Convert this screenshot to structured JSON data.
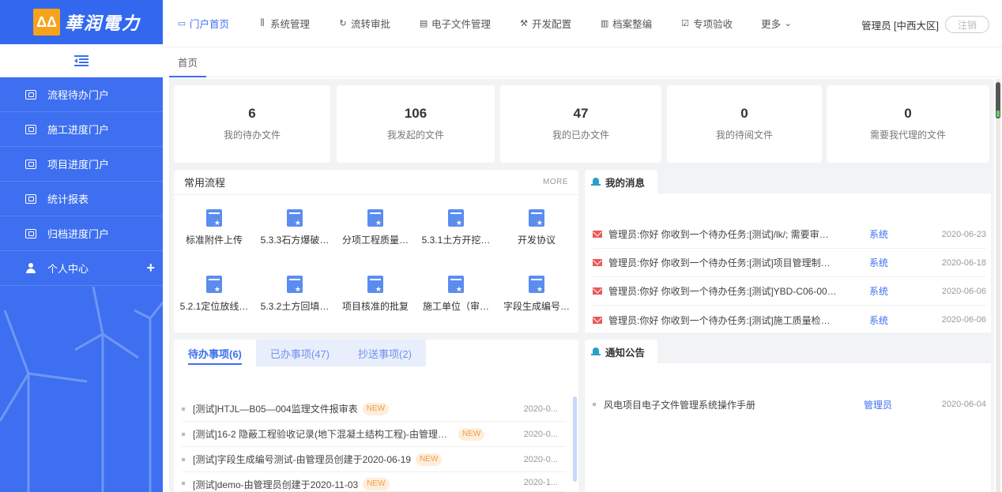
{
  "logo": {
    "mark": "ΔΔ",
    "text": "華润電力"
  },
  "sidebar": {
    "items": [
      {
        "label": "流程待办门户"
      },
      {
        "label": "施工进度门户"
      },
      {
        "label": "项目进度门户"
      },
      {
        "label": "统计报表"
      },
      {
        "label": "归档进度门户"
      },
      {
        "label": "个人中心",
        "expand": "+"
      }
    ]
  },
  "topnav": {
    "items": [
      {
        "label": "门户首页",
        "icon": "▭"
      },
      {
        "label": "系统管理",
        "icon": "⫼"
      },
      {
        "label": "流转审批",
        "icon": "↻"
      },
      {
        "label": "电子文件管理",
        "icon": "▤"
      },
      {
        "label": "开发配置",
        "icon": "⚒"
      },
      {
        "label": "档案整编",
        "icon": "▥"
      },
      {
        "label": "专项验收",
        "icon": "☑"
      },
      {
        "label": "更多",
        "icon": "⌄"
      }
    ],
    "user": "管理员 [中西大区]",
    "logout": "注销"
  },
  "tabs": {
    "current": "首页"
  },
  "stats": [
    {
      "value": "6",
      "label": "我的待办文件"
    },
    {
      "value": "106",
      "label": "我发起的文件"
    },
    {
      "value": "47",
      "label": "我的已办文件"
    },
    {
      "value": "0",
      "label": "我的待阅文件"
    },
    {
      "value": "0",
      "label": "需要我代理的文件"
    }
  ],
  "common_flows": {
    "title": "常用流程",
    "more": "MORE",
    "items": [
      "标准附件上传",
      "5.3.3石方爆破…",
      "分项工程质量…",
      "5.3.1土方开挖…",
      "开发协议",
      "5.2.1定位放线…",
      "5.3.2土方回填…",
      "项目核准的批复",
      "施工单位（审…",
      "字段生成编号…"
    ]
  },
  "tasks": {
    "tabs": [
      "待办事项(6)",
      "已办事项(47)",
      "抄送事项(2)"
    ],
    "rows": [
      {
        "text": "[测试]HTJL—B05—004监理文件报审表",
        "badge": "NEW",
        "date": "2020-0..."
      },
      {
        "text": "[测试]16-2 隐蔽工程验收记录(地下混凝土结构工程)-由管理员...",
        "badge": "NEW",
        "date": "2020-0..."
      },
      {
        "text": "[测试]字段生成编号测试-由管理员创建于2020-06-19",
        "badge": "NEW",
        "date": "2020-0..."
      },
      {
        "text": "[测试]demo-由管理员创建于2020-11-03",
        "badge": "NEW",
        "date": "2020-1..."
      }
    ]
  },
  "messages": {
    "title": "我的消息",
    "rows": [
      {
        "text": "管理员:你好 你收到一个待办任务:[测试]/lk/; 需要审批,...",
        "source": "系统",
        "date": "2020-06-23"
      },
      {
        "text": "管理员:你好 你收到一个待办任务:[测试]项目管理制度 ...",
        "source": "系统",
        "date": "2020-06-18"
      },
      {
        "text": "管理员:你好 你收到一个待办任务:[测试]YBD-C06-001...",
        "source": "系统",
        "date": "2020-06-06"
      },
      {
        "text": "管理员:你好 你收到一个待办任务:[测试]施工质量检验...",
        "source": "系统",
        "date": "2020-06-06"
      }
    ]
  },
  "notices": {
    "title": "通知公告",
    "rows": [
      {
        "text": "风电项目电子文件管理系统操作手册",
        "source": "管理员",
        "date": "2020-06-04"
      }
    ]
  },
  "colors": {
    "primary": "#3d6ff0",
    "sidebar": "#3d6ff0",
    "accent": "#f7a21b",
    "badge": "#f39c4a"
  }
}
